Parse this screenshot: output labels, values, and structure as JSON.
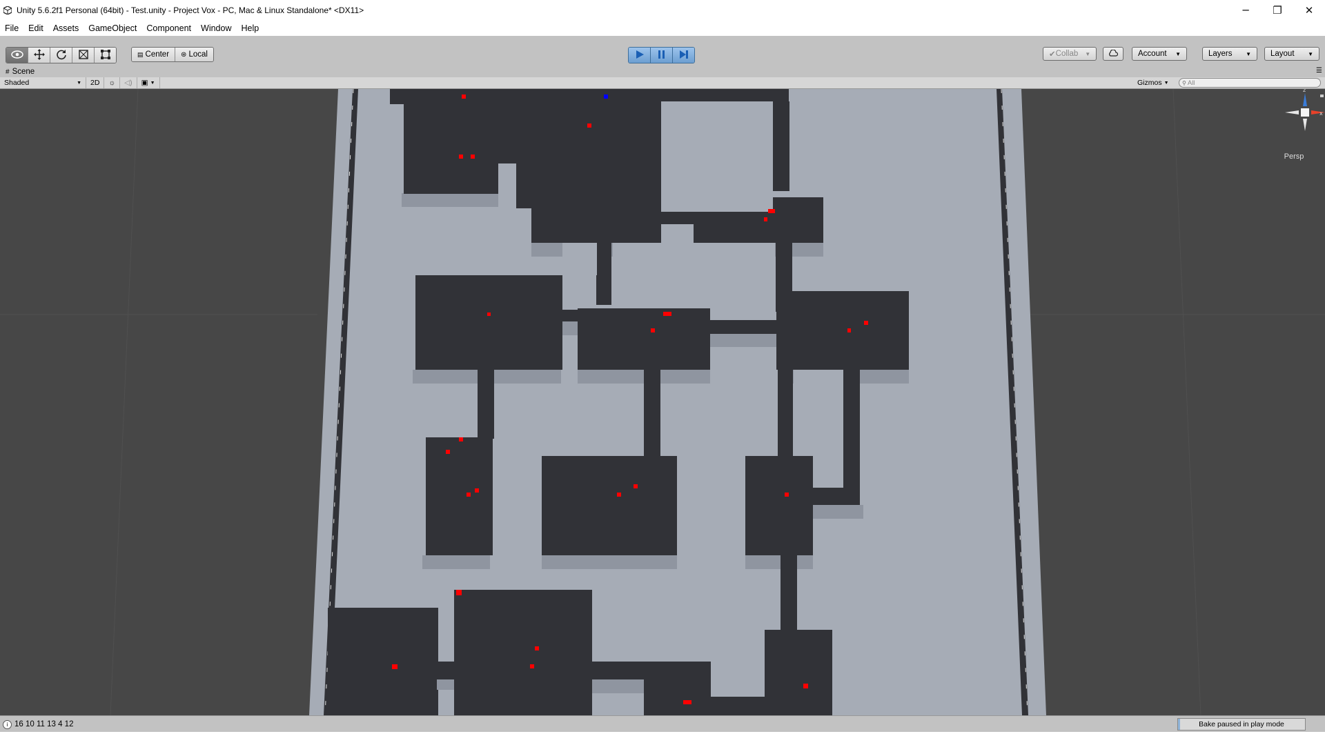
{
  "window": {
    "title": "Unity 5.6.2f1 Personal (64bit) - Test.unity - Project Vox - PC, Mac & Linux Standalone* <DX11>",
    "controls": {
      "minimize": "─",
      "restore": "❐",
      "close": "✕"
    }
  },
  "menu": [
    "File",
    "Edit",
    "Assets",
    "GameObject",
    "Component",
    "Window",
    "Help"
  ],
  "toolbar": {
    "tools": [
      {
        "name": "view-tool",
        "icon": "eye-icon",
        "active": true
      },
      {
        "name": "move-tool",
        "icon": "move-icon",
        "active": false
      },
      {
        "name": "rotate-tool",
        "icon": "rotate-icon",
        "active": false
      },
      {
        "name": "scale-tool",
        "icon": "scale-icon",
        "active": false
      },
      {
        "name": "rect-tool",
        "icon": "rect-icon",
        "active": false
      }
    ],
    "pivot_label": "Center",
    "space_label": "Local",
    "collab_label": "Collab",
    "account_label": "Account",
    "layers_label": "Layers",
    "layout_label": "Layout",
    "play_state": "playing-paused"
  },
  "scene": {
    "tab_label": "Scene",
    "shading_mode": "Shaded",
    "mode_2d_label": "2D",
    "gizmos_label": "Gizmos",
    "search_placeholder": "All",
    "projection_label": "Persp",
    "gizmo_axes": {
      "z": "z",
      "x": "x"
    }
  },
  "status": {
    "console_text": "16 10 11 13 4 12",
    "bake_text": "Bake paused in play mode"
  },
  "colors": {
    "floor": "#a6acb6",
    "wall": "#313237",
    "enemy_marker": "#ff0000",
    "player_marker": "#0000ff",
    "play_accent": "#6d9fd1"
  }
}
